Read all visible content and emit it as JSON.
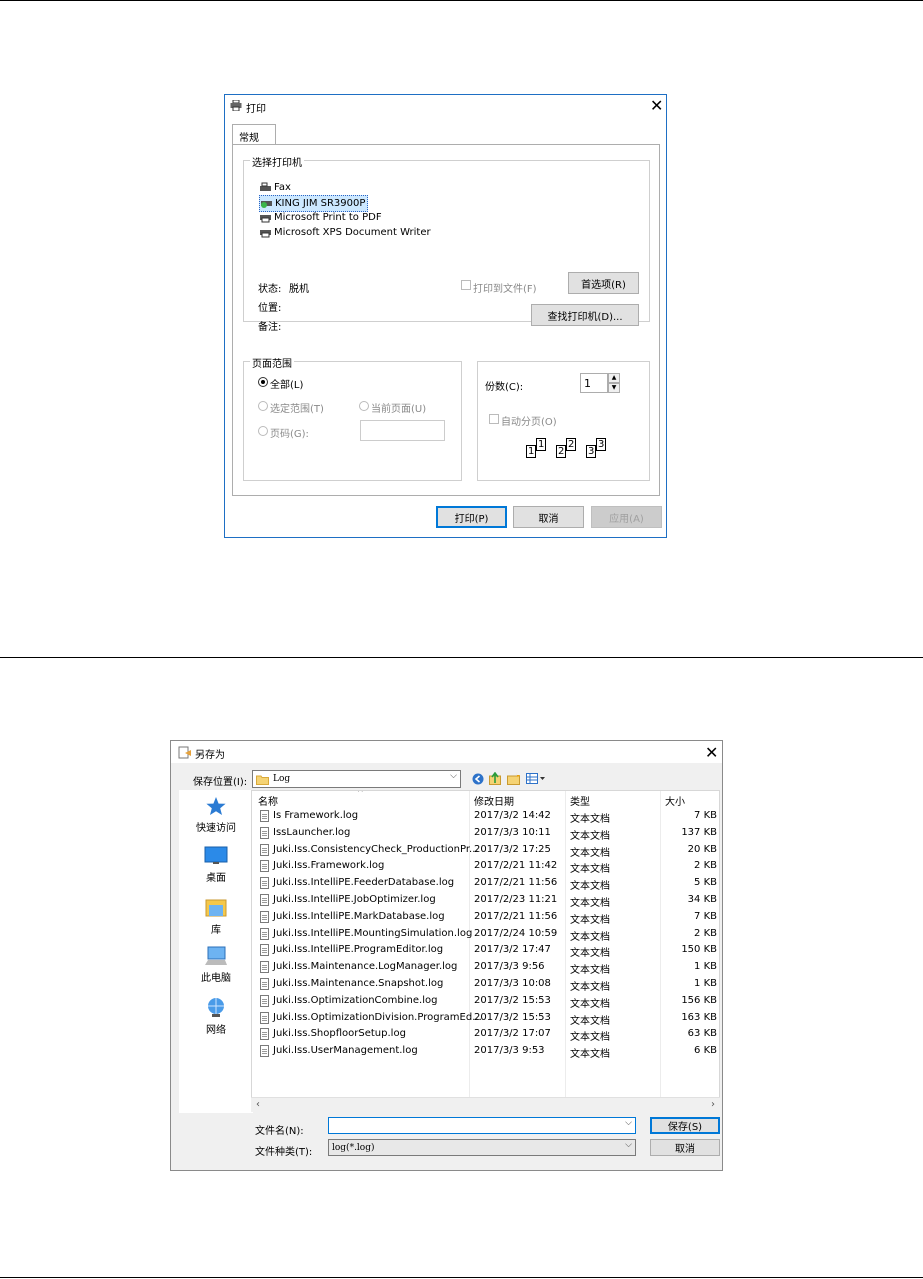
{
  "print_dialog": {
    "title": "打印",
    "tab": "常规",
    "select_printer_label": "选择打印机",
    "printers": [
      {
        "name": "Fax",
        "selected": false
      },
      {
        "name": "KING JIM SR3900P",
        "selected": true
      },
      {
        "name": "Microsoft Print to PDF",
        "selected": false
      },
      {
        "name": "Microsoft XPS Document Writer",
        "selected": false
      }
    ],
    "status_label": "状态:",
    "status_value": "脱机",
    "location_label": "位置:",
    "comment_label": "备注:",
    "print_to_file": "打印到文件(F)",
    "preferences_button": "首选项(R)",
    "find_printer_button": "查找打印机(D)...",
    "page_range": {
      "label": "页面范围",
      "all": "全部(L)",
      "selection": "选定范围(T)",
      "current_page": "当前页面(U)",
      "pages": "页码(G):"
    },
    "copies": {
      "label": "份数(C):",
      "value": "1",
      "collate": "自动分页(O)",
      "sheet_numbers": [
        "1",
        "1",
        "2",
        "2",
        "3",
        "3"
      ]
    },
    "buttons": {
      "print": "打印(P)",
      "cancel": "取消",
      "apply": "应用(A)"
    }
  },
  "save_dialog": {
    "title": "另存为",
    "save_in_label": "保存位置(I):",
    "folder": "Log",
    "places": [
      "快速访问",
      "桌面",
      "库",
      "此电脑",
      "网络"
    ],
    "columns": [
      "名称",
      "修改日期",
      "类型",
      "大小"
    ],
    "files": [
      {
        "name": "Is Framework.log",
        "date": "2017/3/2 14:42",
        "type": "文本文档",
        "size": "7 KB"
      },
      {
        "name": "IssLauncher.log",
        "date": "2017/3/3 10:11",
        "type": "文本文档",
        "size": "137 KB"
      },
      {
        "name": "Juki.Iss.ConsistencyCheck_ProductionPr...",
        "date": "2017/3/2 17:25",
        "type": "文本文档",
        "size": "20 KB"
      },
      {
        "name": "Juki.Iss.Framework.log",
        "date": "2017/2/21 11:42",
        "type": "文本文档",
        "size": "2 KB"
      },
      {
        "name": "Juki.Iss.IntelliPE.FeederDatabase.log",
        "date": "2017/2/21 11:56",
        "type": "文本文档",
        "size": "5 KB"
      },
      {
        "name": "Juki.Iss.IntelliPE.JobOptimizer.log",
        "date": "2017/2/23 11:21",
        "type": "文本文档",
        "size": "34 KB"
      },
      {
        "name": "Juki.Iss.IntelliPE.MarkDatabase.log",
        "date": "2017/2/21 11:56",
        "type": "文本文档",
        "size": "7 KB"
      },
      {
        "name": "Juki.Iss.IntelliPE.MountingSimulation.log",
        "date": "2017/2/24 10:59",
        "type": "文本文档",
        "size": "2 KB"
      },
      {
        "name": "Juki.Iss.IntelliPE.ProgramEditor.log",
        "date": "2017/3/2 17:47",
        "type": "文本文档",
        "size": "150 KB"
      },
      {
        "name": "Juki.Iss.Maintenance.LogManager.log",
        "date": "2017/3/3 9:56",
        "type": "文本文档",
        "size": "1 KB"
      },
      {
        "name": "Juki.Iss.Maintenance.Snapshot.log",
        "date": "2017/3/3 10:08",
        "type": "文本文档",
        "size": "1 KB"
      },
      {
        "name": "Juki.Iss.OptimizationCombine.log",
        "date": "2017/3/2 15:53",
        "type": "文本文档",
        "size": "156 KB"
      },
      {
        "name": "Juki.Iss.OptimizationDivision.ProgramEd...",
        "date": "2017/3/2 15:53",
        "type": "文本文档",
        "size": "163 KB"
      },
      {
        "name": "Juki.Iss.ShopfloorSetup.log",
        "date": "2017/3/2 17:07",
        "type": "文本文档",
        "size": "63 KB"
      },
      {
        "name": "Juki.Iss.UserManagement.log",
        "date": "2017/3/3 9:53",
        "type": "文本文档",
        "size": "6 KB"
      }
    ],
    "filename_label": "文件名(N):",
    "filename_value": "",
    "filetype_label": "文件种类(T):",
    "filetype_value": "log(*.log)",
    "save_button": "保存(S)",
    "cancel_button": "取消"
  }
}
